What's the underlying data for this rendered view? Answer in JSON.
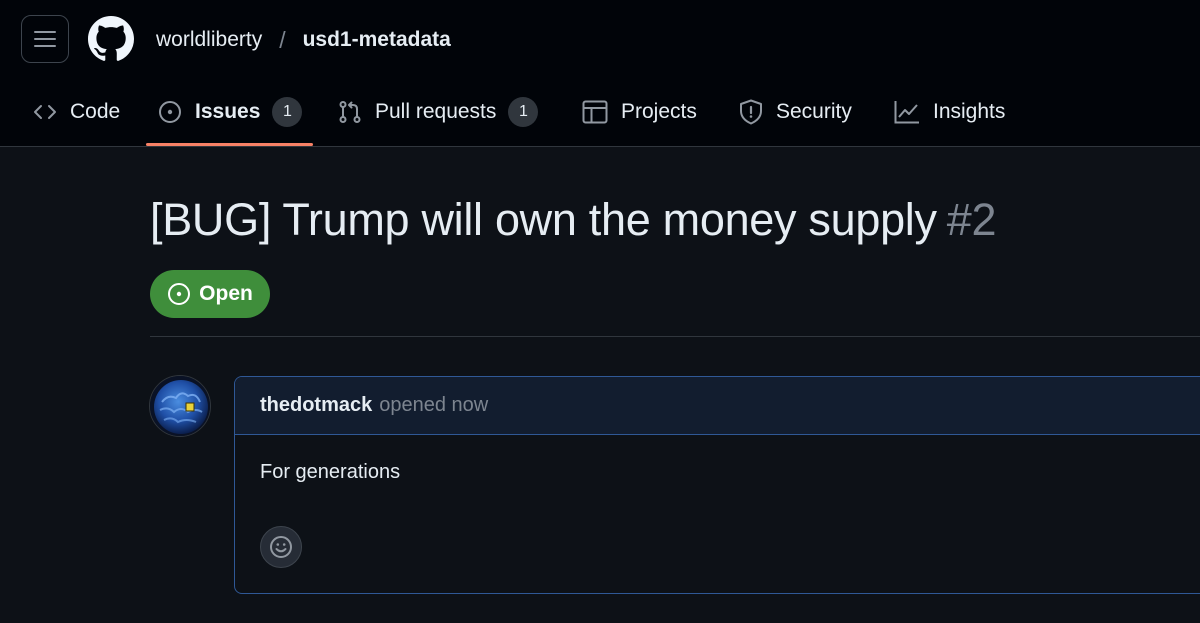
{
  "header": {
    "menu_icon": "hamburger-icon",
    "logo_icon": "github-mark-icon",
    "breadcrumb": {
      "owner": "worldliberty",
      "separator": "/",
      "repo": "usd1-metadata"
    }
  },
  "tabs": [
    {
      "label": "Code",
      "icon": "code-icon",
      "selected": false
    },
    {
      "label": "Issues",
      "icon": "issue-opened-icon",
      "count": "1",
      "selected": true
    },
    {
      "label": "Pull requests",
      "icon": "git-pull-request-icon",
      "count": "1",
      "selected": false
    },
    {
      "label": "Projects",
      "icon": "table-icon",
      "selected": false
    },
    {
      "label": "Security",
      "icon": "shield-icon",
      "selected": false
    },
    {
      "label": "Insights",
      "icon": "graph-icon",
      "selected": false
    }
  ],
  "issue": {
    "title": "[BUG] Trump will own the money supply",
    "number": "#2",
    "state": "Open",
    "state_icon": "issue-opened-icon"
  },
  "comment": {
    "author": "thedotmack",
    "action": "opened now",
    "body": "For generations",
    "reaction_icon": "smiley-icon"
  },
  "colors": {
    "header_bg": "#010409",
    "page_bg": "#0d1117",
    "tab_underline": "#f78166",
    "open_badge": "#3f8e3b",
    "comment_border": "#2f5896",
    "comment_header_bg": "#121d2f",
    "muted_text": "#7d8590"
  }
}
